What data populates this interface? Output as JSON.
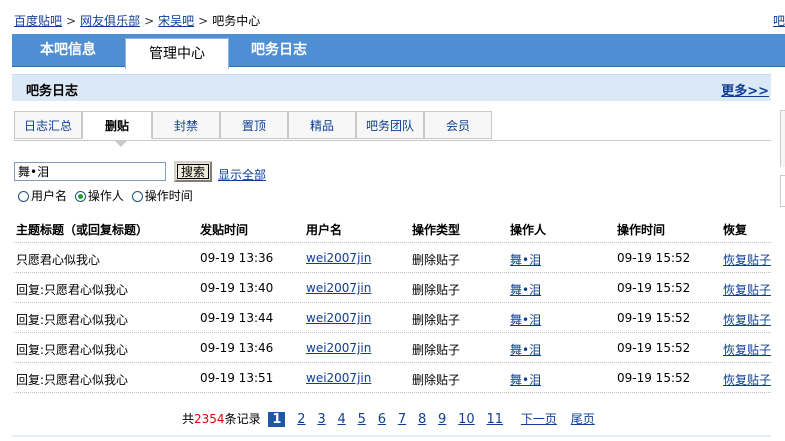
{
  "breadcrumb": {
    "items": [
      "百度贴吧",
      "网友俱乐部",
      "宋吴吧"
    ],
    "current": "吧务中心",
    "separator": ">"
  },
  "main_tabs": [
    {
      "label": "本吧信息",
      "active": false
    },
    {
      "label": "管理中心",
      "active": true
    },
    {
      "label": "吧务日志",
      "active": false
    }
  ],
  "section": {
    "title": "吧务日志",
    "more_label": "更多>>"
  },
  "sub_tabs": [
    {
      "label": "日志汇总",
      "active": false
    },
    {
      "label": "删贴",
      "active": true
    },
    {
      "label": "封禁",
      "active": false
    },
    {
      "label": "置顶",
      "active": false
    },
    {
      "label": "精品",
      "active": false
    },
    {
      "label": "吧务团队",
      "active": false
    },
    {
      "label": "会员",
      "active": false
    }
  ],
  "search": {
    "value": "舞•泪",
    "button_label": "搜索",
    "show_all_label": "显示全部",
    "options": [
      {
        "label": "用户名",
        "checked": false
      },
      {
        "label": "操作人",
        "checked": true
      },
      {
        "label": "操作时间",
        "checked": false
      }
    ]
  },
  "table": {
    "headers": [
      "主题标题（或回复标题）",
      "发贴时间",
      "用户名",
      "操作类型",
      "操作人",
      "操作时间",
      "恢复"
    ],
    "rows": [
      {
        "title": "只愿君心似我心",
        "post_time": "09-19 13:36",
        "username": "wei2007jin",
        "op_type": "删除贴子",
        "operator": "舞•泪",
        "op_time": "09-19 15:52",
        "restore": "恢复贴子"
      },
      {
        "title": "回复:只愿君心似我心",
        "post_time": "09-19 13:40",
        "username": "wei2007jin",
        "op_type": "删除贴子",
        "operator": "舞•泪",
        "op_time": "09-19 15:52",
        "restore": "恢复贴子"
      },
      {
        "title": "回复:只愿君心似我心",
        "post_time": "09-19 13:44",
        "username": "wei2007jin",
        "op_type": "删除贴子",
        "operator": "舞•泪",
        "op_time": "09-19 15:52",
        "restore": "恢复贴子"
      },
      {
        "title": "回复:只愿君心似我心",
        "post_time": "09-19 13:46",
        "username": "wei2007jin",
        "op_type": "删除贴子",
        "operator": "舞•泪",
        "op_time": "09-19 15:52",
        "restore": "恢复贴子"
      },
      {
        "title": "回复:只愿君心似我心",
        "post_time": "09-19 13:51",
        "username": "wei2007jin",
        "op_type": "删除贴子",
        "operator": "舞•泪",
        "op_time": "09-19 15:52",
        "restore": "恢复贴子"
      }
    ]
  },
  "pagination": {
    "prefix": "共",
    "total": "2354",
    "suffix": "条记录",
    "current_page": "1",
    "pages": [
      "2",
      "3",
      "4",
      "5",
      "6",
      "7",
      "8",
      "9",
      "10",
      "11"
    ],
    "next_label": "下一页",
    "last_label": "尾页"
  },
  "right_edge_link": "吧"
}
